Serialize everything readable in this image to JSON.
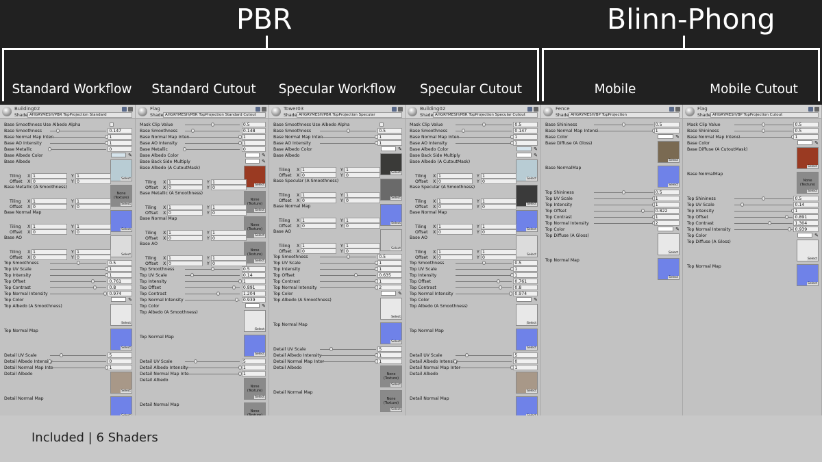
{
  "header": {
    "pbr": "PBR",
    "bp": "Blinn-Phong",
    "cols": [
      "Standard Workflow",
      "Standard Cutout",
      "Specular Workflow",
      "Specular Cutout",
      "Mobile",
      "Mobile Cutout"
    ]
  },
  "footer": "Included | 6 Shaders",
  "labels": {
    "shader": "Shader",
    "select": "Select",
    "none": "None\n(Texture)",
    "tiling": "Tiling",
    "offset": "Offset",
    "x": "X",
    "y": "Y"
  },
  "panels": [
    {
      "name": "Building02",
      "shader": "AHGRYMESH/PBR TopProjection Standard",
      "rows": [
        {
          "l": "Base Smoothness Use Albedo Alpha",
          "c": 1
        },
        {
          "l": "Base Smoothness",
          "s": 0.147,
          "v": "0.147"
        },
        {
          "l": "Base Normal Map Inten",
          "s": 1,
          "v": "1"
        },
        {
          "l": "Base AO Intensity",
          "s": 1,
          "v": "1"
        },
        {
          "l": "Base Metallic",
          "s": 0,
          "v": "0"
        },
        {
          "l": "Base Albedo Color",
          "co": "#d6e4ec"
        },
        {
          "l": "Base Albedo",
          "tex": "#b8ccd4"
        },
        {
          "l": "Base Metallic (A Smoothness)",
          "tex": "none"
        },
        {
          "l": "Base Normal Map",
          "tex": "#6f82e8"
        },
        {
          "l": "Base AO",
          "tex": "#dcdcdc"
        },
        {
          "l": "Top Smoothness",
          "s": 0.5,
          "v": "0.5"
        },
        {
          "l": "Top UV Scale",
          "s": 1,
          "v": "1"
        },
        {
          "l": "Top Intensity",
          "s": 1,
          "v": "1"
        },
        {
          "l": "Top Offset",
          "s": 0.761,
          "v": "0.761"
        },
        {
          "l": "Top Contrast",
          "s": 0.8,
          "v": "0.8"
        },
        {
          "l": "Top Normal Intensity",
          "s": 0.974,
          "v": "0.974"
        },
        {
          "l": "Top Color",
          "co": "#ffffff"
        },
        {
          "l": "Top Albedo (A Smoothness)",
          "tex": "#e8e8e8"
        },
        {
          "l": "Top Normal Map",
          "tex": "#6f82e8"
        },
        {
          "l": "Detail UV Scale",
          "s": 0.2,
          "v": "5"
        },
        {
          "l": "Detail Albedo Intensity",
          "s": 0,
          "v": "0"
        },
        {
          "l": "Detail Normal Map Inte",
          "s": 1,
          "v": "1"
        },
        {
          "l": "Detail Albedo",
          "tex": "#a89888"
        },
        {
          "l": "Detail Normal Map",
          "tex": "#6f82e8"
        }
      ]
    },
    {
      "name": "Flag",
      "shader": "AHGRYMESH/PBR TopProjection Standard Cutout",
      "rows": [
        {
          "l": "Mask Clip Value",
          "s": 0.5,
          "v": "0.5"
        },
        {
          "l": "Base Smoothness",
          "s": 0.148,
          "v": "0.148"
        },
        {
          "l": "Base Normal Map Inten",
          "s": 1,
          "v": "1"
        },
        {
          "l": "Base AO Intensity",
          "s": 1,
          "v": "1"
        },
        {
          "l": "Base Metallic",
          "s": 0,
          "v": "0"
        },
        {
          "l": "Base Albedo Color",
          "co": "#ffffff"
        },
        {
          "l": "Base Back Side Multiply",
          "co": "#ffffff"
        },
        {
          "l": "Base Albedo (A CutoutMask)",
          "tex": "#9a3a22"
        },
        {
          "l": "Base Metallic (A Smoothness)",
          "tex": "none"
        },
        {
          "l": "Base Normal Map",
          "tex": "none"
        },
        {
          "l": "Base AO",
          "tex": "none"
        },
        {
          "l": "Top Smoothness",
          "s": 0.5,
          "v": "0.5"
        },
        {
          "l": "Top UV Scale",
          "s": 0.14,
          "v": "0.14"
        },
        {
          "l": "Top Intensity",
          "s": 1,
          "v": "1"
        },
        {
          "l": "Top Offset",
          "s": 0.891,
          "v": "0.891"
        },
        {
          "l": "Top Contrast",
          "s": 0.6,
          "v": "1.204"
        },
        {
          "l": "Top Normal Intensity",
          "s": 0.939,
          "v": "0.939"
        },
        {
          "l": "Top Color",
          "co": "#ffffff"
        },
        {
          "l": "Top Albedo (A Smoothness)",
          "tex": "#e8e8e8"
        },
        {
          "l": "Top Normal Map",
          "tex": "#6f82e8"
        },
        {
          "l": "Detail UV Scale",
          "s": 0.2,
          "v": "5"
        },
        {
          "l": "Detail Albedo Intensity",
          "s": 1,
          "v": "1"
        },
        {
          "l": "Detail Normal Map Inte",
          "s": 1,
          "v": "1"
        },
        {
          "l": "Detail Albedo",
          "tex": "none"
        },
        {
          "l": "Detail Normal Map",
          "tex": "none"
        }
      ]
    },
    {
      "name": "Tower03",
      "shader": "AHGRYMESH/PBR TopProjection Specular",
      "rows": [
        {
          "l": "Base Smoothness Use Albedo Alpha",
          "c": 1
        },
        {
          "l": "Base Smoothness",
          "s": 0.5,
          "v": "0.5"
        },
        {
          "l": "Base Normal Map Inten",
          "s": 1,
          "v": "1"
        },
        {
          "l": "Base AO Intensity",
          "s": 1,
          "v": "1"
        },
        {
          "l": "Base Albedo Color",
          "co": "#ffffff"
        },
        {
          "l": "Base Albedo",
          "tex": "#3a3a38"
        },
        {
          "l": "Base Specular (A Smoothness)",
          "tex": "#6a6a6a"
        },
        {
          "l": "Base Normal Map",
          "tex": "#6f82e8"
        },
        {
          "l": "Base AO",
          "tex": "#c8c8c8"
        },
        {
          "l": "Top Smoothness",
          "s": 0.5,
          "v": "0.5"
        },
        {
          "l": "Top UV Scale",
          "s": 1,
          "v": "1"
        },
        {
          "l": "Top Intensity",
          "s": 1,
          "v": "1"
        },
        {
          "l": "Top Offset",
          "s": 0.635,
          "v": "0.635"
        },
        {
          "l": "Top Contrast",
          "s": 1,
          "v": "1"
        },
        {
          "l": "Top Normal Intensity",
          "s": 1,
          "v": "2"
        },
        {
          "l": "Top Color",
          "co": "#ffffff"
        },
        {
          "l": "Top Albedo (A Smoothness)",
          "tex": "#e8e8e8"
        },
        {
          "l": "Top Normal Map",
          "tex": "#6f82e8"
        },
        {
          "l": "Detail UV Scale",
          "s": 0.2,
          "v": "5"
        },
        {
          "l": "Detail Albedo Intensity",
          "s": 1,
          "v": "1"
        },
        {
          "l": "Detail Normal Map Inter",
          "s": 1,
          "v": "1"
        },
        {
          "l": "Detail Albedo",
          "tex": "none"
        },
        {
          "l": "Detail Normal Map",
          "tex": "none"
        }
      ]
    },
    {
      "name": "Building02",
      "shader": "AHGRYMESH/PBR TopProjection Specular Cutout",
      "rows": [
        {
          "l": "Mask Clip Value",
          "s": 0.5,
          "v": "0.5"
        },
        {
          "l": "Base Smoothness",
          "s": 0.147,
          "v": "0.147"
        },
        {
          "l": "Base Normal Map Inten",
          "s": 1,
          "v": "1"
        },
        {
          "l": "Base AO Intensity",
          "s": 1,
          "v": "1"
        },
        {
          "l": "Base Albedo Color",
          "co": "#d6e4ec"
        },
        {
          "l": "Base Back Side Multiply",
          "co": "#ffffff"
        },
        {
          "l": "Base Albedo (A CutoutMask)",
          "tex": "#b8ccd4"
        },
        {
          "l": "Base Specular (A Smoothness)",
          "tex": "#3a3a3a"
        },
        {
          "l": "Base Normal Map",
          "tex": "#6f82e8"
        },
        {
          "l": "Base AO",
          "tex": "#dcdcdc"
        },
        {
          "l": "Top Smoothness",
          "s": 0.5,
          "v": "0.5"
        },
        {
          "l": "Top UV Scale",
          "s": 1,
          "v": "1"
        },
        {
          "l": "Top Intensity",
          "s": 1,
          "v": "1"
        },
        {
          "l": "Top Offset",
          "s": 0.761,
          "v": "0.761"
        },
        {
          "l": "Top Contrast",
          "s": 0.8,
          "v": "0.8"
        },
        {
          "l": "Top Normal Intensity",
          "s": 0.974,
          "v": "0.974"
        },
        {
          "l": "Top Color",
          "co": "#ffffff"
        },
        {
          "l": "Top Albedo (A Smoothness)",
          "tex": "#e8e8e8"
        },
        {
          "l": "Top Normal Map",
          "tex": "#6f82e8"
        },
        {
          "l": "Detail UV Scale",
          "s": 0.2,
          "v": "5"
        },
        {
          "l": "Detail Albedo Intensity",
          "s": 0,
          "v": "0"
        },
        {
          "l": "Detail Normal Map Inter",
          "s": 1,
          "v": "1"
        },
        {
          "l": "Detail Albedo",
          "tex": "#a89888"
        },
        {
          "l": "Detail Normal Map",
          "tex": "#6f82e8"
        }
      ]
    },
    {
      "name": "Fence",
      "shader": "AHGRYMESH/BP TopProjection",
      "rows": [
        {
          "l": "Base Shininess",
          "s": 0.5,
          "v": "0.5"
        },
        {
          "l": "Base Normal Map Intensi",
          "s": 1,
          "v": "1"
        },
        {
          "l": "Base Color",
          "co": "#ffffff"
        },
        {
          "l": "Base Diffuse (A Gloss)",
          "tex": "#7a6a52"
        },
        {
          "l": "Base NormalMap",
          "tex": "#6f82e8"
        },
        {
          "l": "Top Shininess",
          "s": 0.5,
          "v": "0.5"
        },
        {
          "l": "Top UV Scale",
          "s": 1,
          "v": "1"
        },
        {
          "l": "Top Intensity",
          "s": 1,
          "v": "1"
        },
        {
          "l": "Top Offset",
          "s": 0.822,
          "v": "0.822"
        },
        {
          "l": "Top Contrast",
          "s": 1,
          "v": "1"
        },
        {
          "l": "Top Normal Intensity",
          "s": 1,
          "v": "2"
        },
        {
          "l": "Top Color",
          "co": "#ffffff"
        },
        {
          "l": "Top Diffuse (A Gloss)",
          "tex": "#e8e8e8"
        },
        {
          "l": "Top Normal Map",
          "tex": "#6f82e8"
        }
      ]
    },
    {
      "name": "Flag",
      "shader": "AHGRYMESH/BP TopProjection Cutout",
      "rows": [
        {
          "l": "Mask Clip Value",
          "s": 0.5,
          "v": "0.5"
        },
        {
          "l": "Base Shininess",
          "s": 0.5,
          "v": "0.5"
        },
        {
          "l": "Base Normal Map Intensi",
          "s": 1,
          "v": "1"
        },
        {
          "l": "Base Color",
          "co": "#ffffff"
        },
        {
          "l": "Base Diffuse (A CutoutMask)",
          "tex": "#9a3a22"
        },
        {
          "l": "Base NormalMap",
          "tex": "none"
        },
        {
          "l": "Top Shininess",
          "s": 0.5,
          "v": "0.5"
        },
        {
          "l": "Top UV Scale",
          "s": 0.14,
          "v": "0.14"
        },
        {
          "l": "Top Intensity",
          "s": 1,
          "v": "1"
        },
        {
          "l": "Top Offset",
          "s": 0.891,
          "v": "0.891"
        },
        {
          "l": "Top Contrast",
          "s": 0.6,
          "v": "1.304"
        },
        {
          "l": "Top Normal Intensity",
          "s": 0.939,
          "v": "0.939"
        },
        {
          "l": "Top Color",
          "co": "#ffffff"
        },
        {
          "l": "Top Diffuse (A Gloss)",
          "tex": "#e8e8e8"
        },
        {
          "l": "Top Normal Map",
          "tex": "#6f82e8"
        }
      ]
    }
  ]
}
